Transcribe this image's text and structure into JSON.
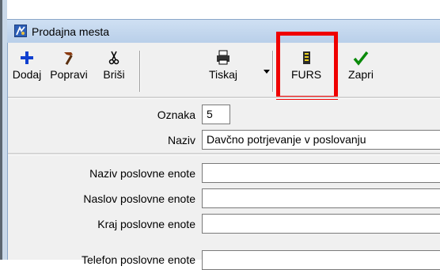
{
  "window": {
    "title": "Prodajna mesta"
  },
  "toolbar": {
    "add_label": "Dodaj",
    "edit_label": "Popravi",
    "delete_label": "Briši",
    "print_label": "Tiskaj",
    "furs_label": "FURS",
    "close_label": "Zapri"
  },
  "form": {
    "oznaka_label": "Oznaka",
    "oznaka_value": "5",
    "naziv_label": "Naziv",
    "naziv_value": "Davčno potrjevanje v poslovanju",
    "unit_name_label": "Naziv poslovne enote",
    "unit_name_value": "",
    "unit_address_label": "Naslov poslovne enote",
    "unit_address_value": "",
    "unit_city_label": "Kraj poslovne enote",
    "unit_city_value": "",
    "unit_phone_label": "Telefon poslovne enote",
    "unit_phone_value": ""
  },
  "colors": {
    "highlight": "#ef0000",
    "add_icon": "#1040d0",
    "close_icon": "#0a8a0a"
  }
}
